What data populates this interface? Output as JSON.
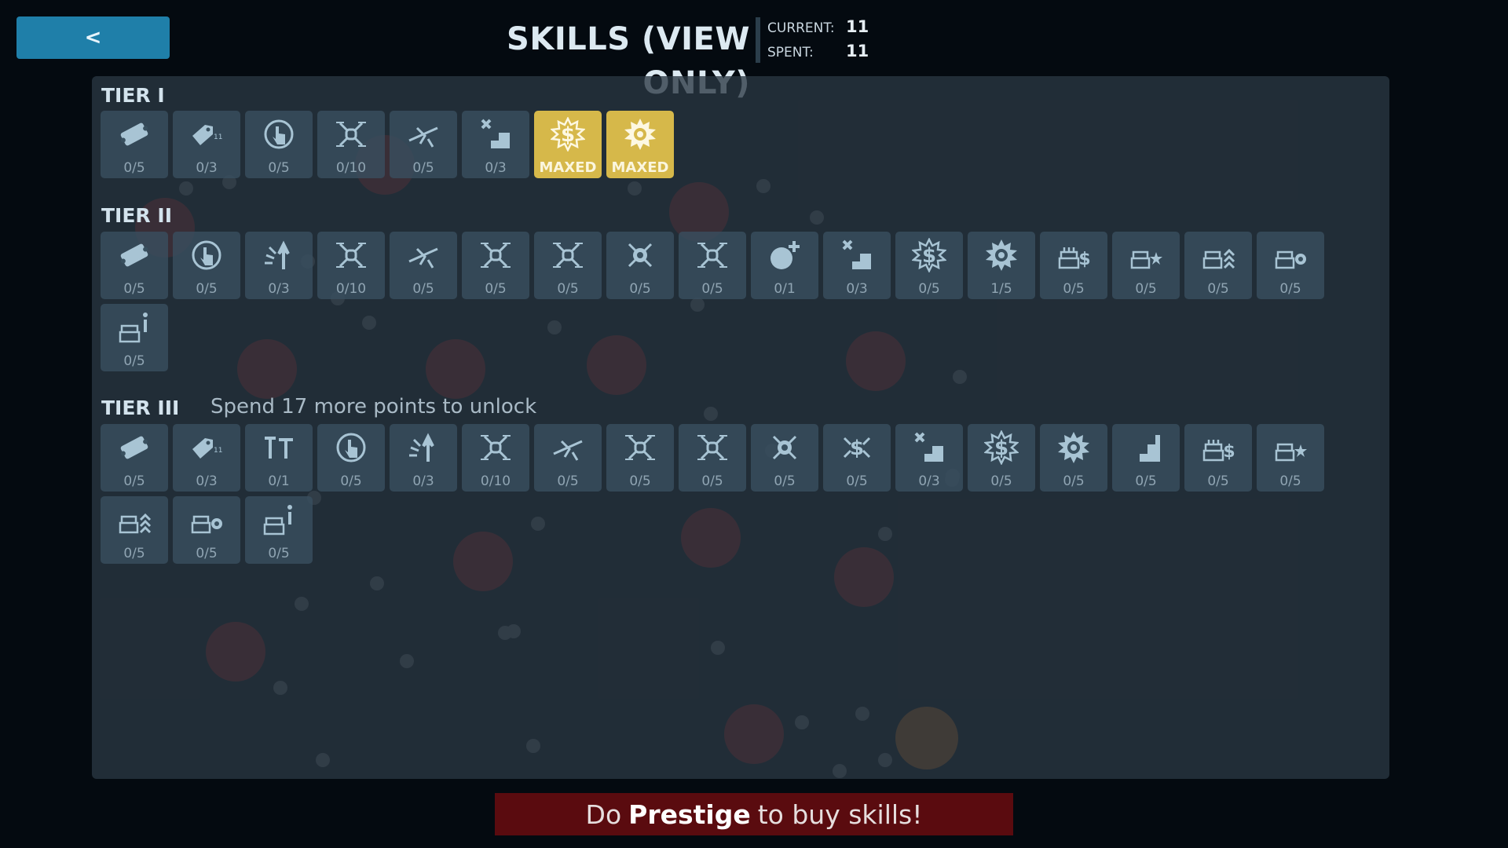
{
  "header": {
    "back_label": "<",
    "title": "SKILLS (VIEW ONLY)",
    "current_label": "CURRENT:",
    "current_value": "11",
    "spent_label": "SPENT:",
    "spent_value": "11"
  },
  "tiers": [
    {
      "title": "TIER I",
      "lock_text": "",
      "skills": [
        {
          "icon": "ticket-icon",
          "count": "0/5",
          "maxed": false
        },
        {
          "icon": "tag-icon",
          "count": "0/3",
          "maxed": false
        },
        {
          "icon": "tap-icon",
          "count": "0/5",
          "maxed": false
        },
        {
          "icon": "drone-icon",
          "count": "0/10",
          "maxed": false
        },
        {
          "icon": "plane-icon",
          "count": "0/5",
          "maxed": false
        },
        {
          "icon": "stairs-x-icon",
          "count": "0/3",
          "maxed": false
        },
        {
          "icon": "money-burst-icon",
          "count": "MAXED",
          "maxed": true
        },
        {
          "icon": "gear-burst-icon",
          "count": "MAXED",
          "maxed": true
        }
      ]
    },
    {
      "title": "TIER II",
      "lock_text": "",
      "skills": [
        {
          "icon": "ticket-icon",
          "count": "0/5",
          "maxed": false
        },
        {
          "icon": "tap-icon",
          "count": "0/5",
          "maxed": false
        },
        {
          "icon": "sparkle-arrow-icon",
          "count": "0/3",
          "maxed": false
        },
        {
          "icon": "drone-icon",
          "count": "0/10",
          "maxed": false
        },
        {
          "icon": "plane-icon",
          "count": "0/5",
          "maxed": false
        },
        {
          "icon": "drone-icon",
          "count": "0/5",
          "maxed": false
        },
        {
          "icon": "drone-icon",
          "count": "0/5",
          "maxed": false
        },
        {
          "icon": "drone-gear-icon",
          "count": "0/5",
          "maxed": false
        },
        {
          "icon": "drone-icon",
          "count": "0/5",
          "maxed": false
        },
        {
          "icon": "bomb-plus-icon",
          "count": "0/1",
          "maxed": false
        },
        {
          "icon": "stairs-x-icon",
          "count": "0/3",
          "maxed": false
        },
        {
          "icon": "money-burst-icon",
          "count": "0/5",
          "maxed": false
        },
        {
          "icon": "gear-burst-icon",
          "count": "1/5",
          "maxed": false
        },
        {
          "icon": "cake-money-icon",
          "count": "0/5",
          "maxed": false
        },
        {
          "icon": "cake-burst-icon",
          "count": "0/5",
          "maxed": false
        },
        {
          "icon": "cake-rank-icon",
          "count": "0/5",
          "maxed": false
        },
        {
          "icon": "cake-gear-icon",
          "count": "0/5",
          "maxed": false
        },
        {
          "icon": "cake-info-icon",
          "count": "0/5",
          "maxed": false
        }
      ]
    },
    {
      "title": "TIER III",
      "lock_text": "Spend 17 more points to unlock",
      "skills": [
        {
          "icon": "ticket-icon",
          "count": "0/5",
          "maxed": false
        },
        {
          "icon": "tag-icon",
          "count": "0/3",
          "maxed": false
        },
        {
          "icon": "hammer-icon",
          "count": "0/1",
          "maxed": false
        },
        {
          "icon": "tap-icon",
          "count": "0/5",
          "maxed": false
        },
        {
          "icon": "sparkle-arrow-icon",
          "count": "0/3",
          "maxed": false
        },
        {
          "icon": "drone-icon",
          "count": "0/10",
          "maxed": false
        },
        {
          "icon": "plane-icon",
          "count": "0/5",
          "maxed": false
        },
        {
          "icon": "drone-icon",
          "count": "0/5",
          "maxed": false
        },
        {
          "icon": "drone-icon",
          "count": "0/5",
          "maxed": false
        },
        {
          "icon": "drone-gear-icon",
          "count": "0/5",
          "maxed": false
        },
        {
          "icon": "drone-money-icon",
          "count": "0/5",
          "maxed": false
        },
        {
          "icon": "stairs-x-icon",
          "count": "0/3",
          "maxed": false
        },
        {
          "icon": "money-burst-icon",
          "count": "0/5",
          "maxed": false
        },
        {
          "icon": "gear-burst-icon",
          "count": "0/5",
          "maxed": false
        },
        {
          "icon": "stairs-icon",
          "count": "0/5",
          "maxed": false
        },
        {
          "icon": "cake-money-icon",
          "count": "0/5",
          "maxed": false
        },
        {
          "icon": "cake-burst-icon",
          "count": "0/5",
          "maxed": false
        },
        {
          "icon": "cake-rank-icon",
          "count": "0/5",
          "maxed": false
        },
        {
          "icon": "cake-gear-icon",
          "count": "0/5",
          "maxed": false
        },
        {
          "icon": "cake-info-icon",
          "count": "0/5",
          "maxed": false
        }
      ]
    }
  ],
  "banner": {
    "prefix": "Do",
    "emphasis": "Prestige",
    "suffix": "to buy skills!"
  },
  "colors": {
    "maxed": "#d6b84a",
    "tile": "#3a5060",
    "panel": "#2a3742",
    "banner": "#5a0b0f",
    "back_button": "#1f7fa9"
  }
}
